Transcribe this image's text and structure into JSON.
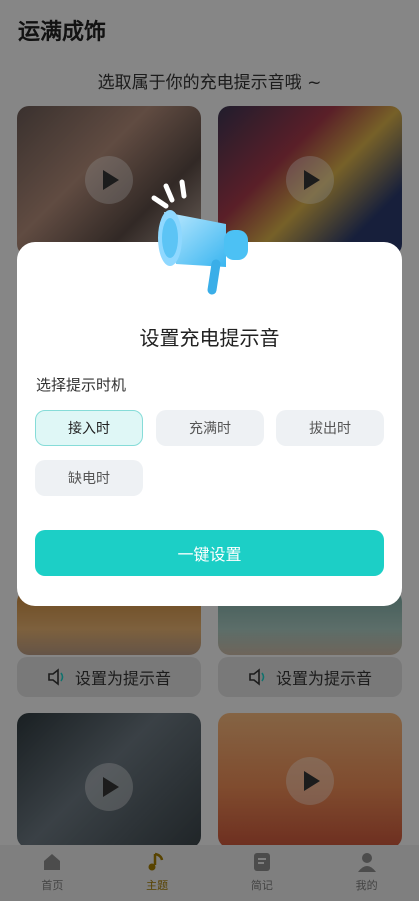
{
  "app": {
    "title": "运满成饰"
  },
  "header": {
    "subtitle": "选取属于你的充电提示音哦 ~"
  },
  "cards": {
    "set_label_left": "设置为提示音",
    "set_label_right": "设置为提示音"
  },
  "dialog": {
    "title": "设置充电提示音",
    "section_label": "选择提示时机",
    "options": [
      {
        "label": "接入时",
        "selected": true
      },
      {
        "label": "充满时",
        "selected": false
      },
      {
        "label": "拔出时",
        "selected": false
      },
      {
        "label": "缺电时",
        "selected": false
      }
    ],
    "confirm_label": "一键设置"
  },
  "nav": {
    "items": [
      {
        "label": "首页",
        "icon": "home-icon"
      },
      {
        "label": "主题",
        "icon": "music-note-icon"
      },
      {
        "label": "简记",
        "icon": "note-icon"
      },
      {
        "label": "我的",
        "icon": "user-icon"
      }
    ],
    "active": "主题"
  },
  "colors": {
    "accent": "#1ccfc6",
    "nav_active": "#a07a00"
  }
}
